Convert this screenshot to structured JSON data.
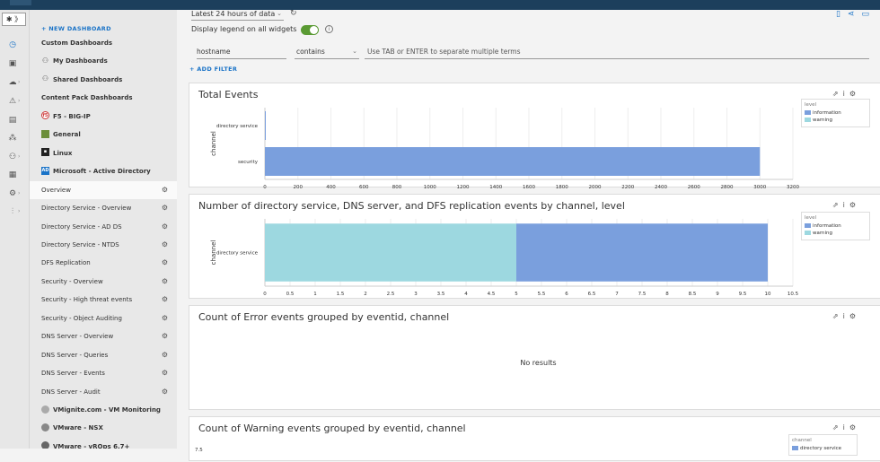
{
  "header": {
    "time_range": "Latest 24 hours of data",
    "display_legend_label": "Display legend on all widgets",
    "display_legend_on": true
  },
  "filter": {
    "field": "hostname",
    "operator": "contains",
    "value_placeholder": "Use TAB or ENTER to separate multiple terms",
    "add_filter_label": "+ ADD FILTER"
  },
  "rail": {
    "pin_label": "✱ 》"
  },
  "sidebar": {
    "new_dashboard": "+ NEW DASHBOARD",
    "items": [
      {
        "label": "Custom Dashboards",
        "kind": "section"
      },
      {
        "label": "My Dashboards",
        "kind": "bold",
        "icon": "person-icon"
      },
      {
        "label": "Shared Dashboards",
        "kind": "bold",
        "icon": "people-icon"
      },
      {
        "label": "Content Pack Dashboards",
        "kind": "section"
      },
      {
        "label": "F5 - BIG-IP",
        "kind": "bold",
        "icon": "f5-logo-icon"
      },
      {
        "label": "General",
        "kind": "bold",
        "icon": "general-pack-icon"
      },
      {
        "label": "Linux",
        "kind": "bold",
        "icon": "linux-pack-icon"
      },
      {
        "label": "Microsoft - Active Directory",
        "kind": "bold",
        "icon": "ad-pack-icon"
      },
      {
        "label": "Overview",
        "kind": "dash",
        "selected": true
      },
      {
        "label": "Directory Service - Overview",
        "kind": "dash"
      },
      {
        "label": "Directory Service - AD DS",
        "kind": "dash"
      },
      {
        "label": "Directory Service - NTDS",
        "kind": "dash"
      },
      {
        "label": "DFS Replication",
        "kind": "dash"
      },
      {
        "label": "Security - Overview",
        "kind": "dash"
      },
      {
        "label": "Security - High threat events",
        "kind": "dash"
      },
      {
        "label": "Security - Object Auditing",
        "kind": "dash"
      },
      {
        "label": "DNS Server - Overview",
        "kind": "dash"
      },
      {
        "label": "DNS Server - Queries",
        "kind": "dash"
      },
      {
        "label": "DNS Server - Events",
        "kind": "dash"
      },
      {
        "label": "DNS Server - Audit",
        "kind": "dash"
      },
      {
        "label": "VMignite.com - VM Monitoring",
        "kind": "bold",
        "icon": "vmignite-pack-icon"
      },
      {
        "label": "VMware - NSX",
        "kind": "bold",
        "icon": "nsx-pack-icon"
      },
      {
        "label": "VMware - vROps 6.7+",
        "kind": "bold",
        "icon": "vrops-pack-icon"
      }
    ]
  },
  "colors": {
    "information": "#7a9fdd",
    "warning": "#9dd8e0",
    "toggle_on": "#5a9a33",
    "accent": "#1a73c7"
  },
  "panels": [
    {
      "title": "Total Events"
    },
    {
      "title": "Number of directory service, DNS server, and DFS replication events by channel, level"
    },
    {
      "title": "Count of Error events grouped by eventid, channel",
      "no_results": "No results"
    },
    {
      "title": "Count of Warning events grouped by eventid, channel"
    }
  ],
  "chart_data": [
    {
      "type": "bar",
      "orientation": "horizontal",
      "stacked": true,
      "title": "Total Events",
      "ylabel": "channel",
      "categories": [
        "directory service",
        "security"
      ],
      "series": [
        {
          "name": "information",
          "values": [
            4,
            3000
          ]
        },
        {
          "name": "warning",
          "values": [
            0,
            0
          ]
        }
      ],
      "xlim": [
        0,
        3200
      ],
      "xticks": [
        "0",
        "200",
        "400",
        "600",
        "800",
        "1000",
        "1200",
        "1400",
        "1600",
        "1800",
        "2000",
        "2200",
        "2400",
        "2600",
        "2800",
        "3000",
        "3200"
      ],
      "legend_title": "level",
      "legend_position": "right",
      "grid": true
    },
    {
      "type": "bar",
      "orientation": "horizontal",
      "stacked": true,
      "title": "Number of directory service, DNS server, and DFS replication events by channel, level",
      "ylabel": "channel",
      "categories": [
        "directory service"
      ],
      "series": [
        {
          "name": "warning",
          "values": [
            5
          ]
        },
        {
          "name": "information",
          "values": [
            5
          ]
        }
      ],
      "xlim": [
        0,
        10.5
      ],
      "xticks": [
        "0",
        "0.5",
        "1",
        "1.5",
        "2",
        "2.5",
        "3",
        "3.5",
        "4",
        "4.5",
        "5",
        "5.5",
        "6",
        "6.5",
        "7",
        "7.5",
        "8",
        "8.5",
        "9",
        "9.5",
        "10",
        "10.5"
      ],
      "legend_title": "level",
      "legend_position": "right",
      "grid": true
    },
    {
      "type": "bar",
      "title": "Count of Warning events grouped by eventid, channel",
      "ylim_max_label": "7.5",
      "legend_title": "channel",
      "legend_entries": [
        "directory service"
      ],
      "legend_position": "right"
    }
  ]
}
